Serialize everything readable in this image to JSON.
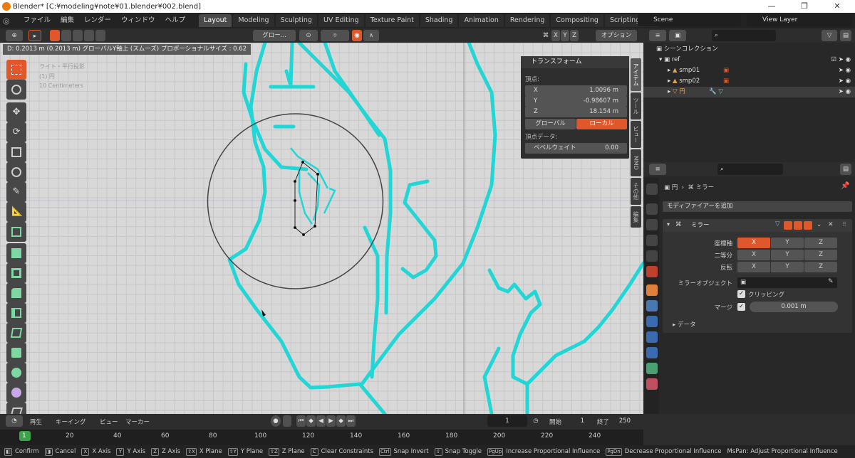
{
  "window": {
    "title": "Blender* [C:¥modeling¥note¥01.blender¥002.blend]"
  },
  "menu": [
    "ファイル",
    "編集",
    "レンダー",
    "ウィンドウ",
    "ヘルプ"
  ],
  "workspaces": [
    "Layout",
    "Modeling",
    "Sculpting",
    "UV Editing",
    "Texture Paint",
    "Shading",
    "Animation",
    "Rendering",
    "Compositing",
    "Scripting"
  ],
  "active_workspace": "Layout",
  "scene": "Scene",
  "view_layer": "View Layer",
  "viewport": {
    "status": "D: 0.2013 m (0.2013 m) グローバルY軸上 (スムーズ) プロポーショナルサイズ : 0.62",
    "info": [
      "ライト・平行投影",
      "(1) 円",
      "10 Centimeters"
    ],
    "orientation": "グロー...",
    "options_label": "オプション",
    "axes": [
      "X",
      "Y",
      "Z"
    ]
  },
  "npanel": {
    "title": "トランスフォーム",
    "vertex_label": "頂点:",
    "x": "1.0096 m",
    "y": "-0.98607 m",
    "z": "18.154 m",
    "global_label": "グローバル",
    "local_label": "ローカル",
    "vertex_data_label": "頂点データ:",
    "bevel_label": "ベベルウェイト",
    "bevel_value": "0.00",
    "tabs": [
      "アイテム",
      "ツール",
      "ビュー",
      "MMD",
      "その他",
      "編集"
    ]
  },
  "outliner": {
    "collection": "シーンコレクション",
    "items": [
      "ref",
      "smp01",
      "smp02",
      "円"
    ]
  },
  "properties": {
    "breadcrumb_object": "円",
    "breadcrumb_modifier": "ミラー",
    "add_modifier": "モディファイアーを追加",
    "modifier_name": "ミラー",
    "axis_label": "座標軸",
    "bisect_label": "二等分",
    "flip_label": "反転",
    "mirror_object_label": "ミラーオブジェクト",
    "clipping_label": "クリッピング",
    "merge_label": "マージ",
    "merge_value": "0.001 m",
    "data_label": "データ"
  },
  "timeline": {
    "playback": "再生",
    "keying": "キーイング",
    "view": "ビュー",
    "marker": "マーカー",
    "current_frame": "1",
    "start_label": "開始",
    "start": "1",
    "end_label": "終了",
    "end": "250",
    "ticks": [
      "1",
      "20",
      "40",
      "60",
      "80",
      "100",
      "120",
      "140",
      "160",
      "180",
      "200",
      "220",
      "240"
    ]
  },
  "statusbar": [
    {
      "key": "",
      "label": "Confirm"
    },
    {
      "key": "",
      "label": "Cancel"
    },
    {
      "key": "X",
      "label": "X Axis"
    },
    {
      "key": "Y",
      "label": "Y Axis"
    },
    {
      "key": "Z",
      "label": "Z Axis"
    },
    {
      "key": "⇧X",
      "label": "X Plane"
    },
    {
      "key": "⇧Y",
      "label": "Y Plane"
    },
    {
      "key": "⇧Z",
      "label": "Z Plane"
    },
    {
      "key": "C",
      "label": "Clear Constraints"
    },
    {
      "key": "Ctrl",
      "label": "Snap Invert"
    },
    {
      "key": "⇧",
      "label": "Snap Toggle"
    },
    {
      "key": "PgUp",
      "label": "Increase Proportional Influence"
    },
    {
      "key": "PgDn",
      "label": "Decrease Proportional Influence"
    },
    {
      "key": "",
      "label": "MsPan: Adjust Proportional Influence"
    }
  ],
  "colors": {
    "accent": "#e0572b",
    "cyan": "#22d6d6",
    "bg": "#303030"
  }
}
